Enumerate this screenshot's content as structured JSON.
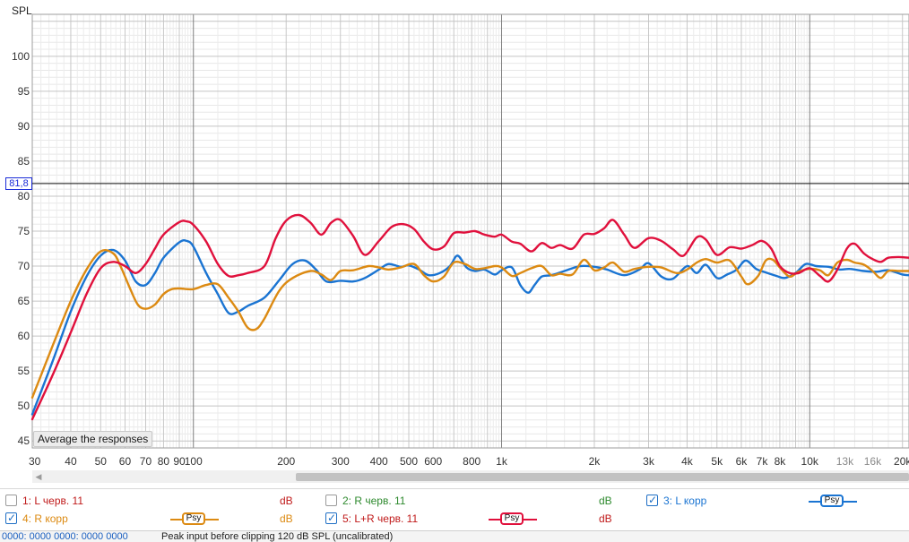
{
  "chart_data": {
    "type": "line",
    "title": "",
    "ylabel": "SPL",
    "xlabel": "",
    "xscale": "log",
    "xlim": [
      30,
      21000
    ],
    "ylim": [
      44,
      106
    ],
    "yticks": [
      "45",
      "50",
      "55",
      "60",
      "65",
      "70",
      "75",
      "80",
      "85",
      "90",
      "95",
      "100"
    ],
    "xticks": [
      {
        "f": 30,
        "label": "30"
      },
      {
        "f": 40,
        "label": "40"
      },
      {
        "f": 50,
        "label": "50"
      },
      {
        "f": 60,
        "label": "60"
      },
      {
        "f": 70,
        "label": "70"
      },
      {
        "f": 80,
        "label": "80"
      },
      {
        "f": 90,
        "label": "90"
      },
      {
        "f": 100,
        "label": "100"
      },
      {
        "f": 200,
        "label": "200"
      },
      {
        "f": 300,
        "label": "300"
      },
      {
        "f": 400,
        "label": "400"
      },
      {
        "f": 500,
        "label": "500"
      },
      {
        "f": 600,
        "label": "600"
      },
      {
        "f": 800,
        "label": "800"
      },
      {
        "f": 1000,
        "label": "1k"
      },
      {
        "f": 2000,
        "label": "2k"
      },
      {
        "f": 3000,
        "label": "3k"
      },
      {
        "f": 4000,
        "label": "4k"
      },
      {
        "f": 5000,
        "label": "5k"
      },
      {
        "f": 6000,
        "label": "6k"
      },
      {
        "f": 7000,
        "label": "7k"
      },
      {
        "f": 8000,
        "label": "8k"
      },
      {
        "f": 10000,
        "label": "10k"
      },
      {
        "f": 13000,
        "label": "13k"
      },
      {
        "f": 16000,
        "label": "16k"
      },
      {
        "f": 20000,
        "label": "20k"
      }
    ],
    "grid": true,
    "cursor_level": 81.8,
    "series": [
      {
        "name": "3: L корр",
        "color": "#1a74d2",
        "points": [
          [
            30,
            48.8
          ],
          [
            35,
            56.5
          ],
          [
            40,
            63.5
          ],
          [
            45,
            68.5
          ],
          [
            50,
            71.5
          ],
          [
            55,
            72.3
          ],
          [
            60,
            70.8
          ],
          [
            65,
            67.8
          ],
          [
            70,
            67.3
          ],
          [
            75,
            69
          ],
          [
            80,
            71.2
          ],
          [
            90,
            73.4
          ],
          [
            95,
            73.6
          ],
          [
            100,
            72.8
          ],
          [
            110,
            69
          ],
          [
            120,
            66
          ],
          [
            130,
            63.3
          ],
          [
            140,
            63.5
          ],
          [
            150,
            64.3
          ],
          [
            170,
            65.5
          ],
          [
            190,
            68
          ],
          [
            210,
            70.3
          ],
          [
            230,
            70.8
          ],
          [
            250,
            69.5
          ],
          [
            270,
            67.8
          ],
          [
            300,
            67.9
          ],
          [
            330,
            67.8
          ],
          [
            360,
            68.3
          ],
          [
            400,
            69.5
          ],
          [
            430,
            70.3
          ],
          [
            470,
            69.9
          ],
          [
            500,
            70.1
          ],
          [
            540,
            69.5
          ],
          [
            580,
            68.7
          ],
          [
            630,
            69
          ],
          [
            680,
            70
          ],
          [
            720,
            71.5
          ],
          [
            770,
            69.8
          ],
          [
            820,
            69.3
          ],
          [
            880,
            69.5
          ],
          [
            950,
            68.8
          ],
          [
            1000,
            69.4
          ],
          [
            1080,
            69.8
          ],
          [
            1150,
            67.3
          ],
          [
            1220,
            66.2
          ],
          [
            1280,
            67.3
          ],
          [
            1350,
            68.5
          ],
          [
            1450,
            68.7
          ],
          [
            1600,
            69.3
          ],
          [
            1800,
            70
          ],
          [
            2000,
            69.9
          ],
          [
            2200,
            69.5
          ],
          [
            2500,
            68.7
          ],
          [
            2800,
            69.5
          ],
          [
            3000,
            70.4
          ],
          [
            3300,
            68.5
          ],
          [
            3600,
            68.2
          ],
          [
            4000,
            70
          ],
          [
            4300,
            69
          ],
          [
            4600,
            70.2
          ],
          [
            5000,
            68.3
          ],
          [
            5400,
            68.8
          ],
          [
            5800,
            69.5
          ],
          [
            6200,
            70.8
          ],
          [
            6700,
            69.6
          ],
          [
            7200,
            69.1
          ],
          [
            7800,
            68.6
          ],
          [
            8300,
            68.3
          ],
          [
            9000,
            69
          ],
          [
            9700,
            70.3
          ],
          [
            10500,
            70
          ],
          [
            11500,
            69.9
          ],
          [
            12500,
            69.5
          ],
          [
            13500,
            69.6
          ],
          [
            15000,
            69.3
          ],
          [
            16500,
            69.2
          ],
          [
            18000,
            69.4
          ],
          [
            20000,
            68.8
          ],
          [
            21000,
            68.7
          ]
        ]
      },
      {
        "name": "4: R корр",
        "color": "#dc8a12",
        "points": [
          [
            30,
            51.2
          ],
          [
            35,
            58.7
          ],
          [
            40,
            65
          ],
          [
            45,
            69.5
          ],
          [
            50,
            72.1
          ],
          [
            55,
            71.8
          ],
          [
            58,
            70
          ],
          [
            62,
            67
          ],
          [
            66,
            64.5
          ],
          [
            70,
            63.9
          ],
          [
            75,
            64.5
          ],
          [
            80,
            66
          ],
          [
            85,
            66.7
          ],
          [
            90,
            66.8
          ],
          [
            100,
            66.7
          ],
          [
            110,
            67.3
          ],
          [
            120,
            67.4
          ],
          [
            130,
            65.5
          ],
          [
            140,
            63.5
          ],
          [
            150,
            61.2
          ],
          [
            160,
            61
          ],
          [
            170,
            62.5
          ],
          [
            190,
            66.5
          ],
          [
            210,
            68.3
          ],
          [
            240,
            69.3
          ],
          [
            260,
            68.8
          ],
          [
            280,
            68
          ],
          [
            300,
            69.3
          ],
          [
            330,
            69.4
          ],
          [
            370,
            70
          ],
          [
            400,
            69.8
          ],
          [
            430,
            69.5
          ],
          [
            470,
            69.8
          ],
          [
            520,
            70.3
          ],
          [
            560,
            68.7
          ],
          [
            600,
            67.8
          ],
          [
            650,
            68.5
          ],
          [
            700,
            70.5
          ],
          [
            760,
            70.3
          ],
          [
            820,
            69.6
          ],
          [
            880,
            69.7
          ],
          [
            950,
            70
          ],
          [
            1000,
            69.8
          ],
          [
            1080,
            68.6
          ],
          [
            1150,
            69
          ],
          [
            1250,
            69.7
          ],
          [
            1350,
            70
          ],
          [
            1450,
            68.7
          ],
          [
            1550,
            68.9
          ],
          [
            1700,
            68.8
          ],
          [
            1850,
            70.9
          ],
          [
            2000,
            69.4
          ],
          [
            2150,
            69.8
          ],
          [
            2300,
            70.5
          ],
          [
            2500,
            69.2
          ],
          [
            2700,
            69.6
          ],
          [
            3000,
            69.9
          ],
          [
            3300,
            69.8
          ],
          [
            3700,
            69
          ],
          [
            4000,
            69.5
          ],
          [
            4300,
            70.5
          ],
          [
            4600,
            71
          ],
          [
            5000,
            70.5
          ],
          [
            5500,
            70.8
          ],
          [
            6000,
            68.5
          ],
          [
            6300,
            67.4
          ],
          [
            6800,
            68.6
          ],
          [
            7200,
            70.8
          ],
          [
            7600,
            70.9
          ],
          [
            8000,
            69.8
          ],
          [
            8600,
            68.5
          ],
          [
            9200,
            69.2
          ],
          [
            10000,
            69.6
          ],
          [
            10800,
            69.4
          ],
          [
            11500,
            68.7
          ],
          [
            12300,
            70.5
          ],
          [
            13200,
            70.9
          ],
          [
            14000,
            70.5
          ],
          [
            15000,
            70.2
          ],
          [
            16000,
            69.3
          ],
          [
            17000,
            68.3
          ],
          [
            18000,
            69.3
          ],
          [
            19500,
            69.3
          ],
          [
            21000,
            69.3
          ]
        ]
      },
      {
        "name": "5: L+R черв. 11",
        "color": "#e0103c",
        "points": [
          [
            30,
            48.1
          ],
          [
            35,
            54.5
          ],
          [
            40,
            60.5
          ],
          [
            45,
            66
          ],
          [
            50,
            69.7
          ],
          [
            55,
            70.6
          ],
          [
            60,
            70
          ],
          [
            65,
            69
          ],
          [
            70,
            70.3
          ],
          [
            75,
            72.5
          ],
          [
            80,
            74.5
          ],
          [
            90,
            76.3
          ],
          [
            95,
            76.4
          ],
          [
            100,
            75.9
          ],
          [
            110,
            73.5
          ],
          [
            120,
            70.3
          ],
          [
            130,
            68.6
          ],
          [
            140,
            68.7
          ],
          [
            150,
            69
          ],
          [
            170,
            70
          ],
          [
            185,
            74
          ],
          [
            200,
            76.5
          ],
          [
            220,
            77.3
          ],
          [
            240,
            76.2
          ],
          [
            260,
            74.5
          ],
          [
            280,
            76.2
          ],
          [
            300,
            76.6
          ],
          [
            330,
            74.3
          ],
          [
            360,
            71.6
          ],
          [
            400,
            73.6
          ],
          [
            440,
            75.6
          ],
          [
            480,
            76
          ],
          [
            520,
            75.3
          ],
          [
            560,
            73.5
          ],
          [
            600,
            72.4
          ],
          [
            650,
            72.8
          ],
          [
            700,
            74.7
          ],
          [
            760,
            74.8
          ],
          [
            820,
            75
          ],
          [
            880,
            74.5
          ],
          [
            950,
            74.2
          ],
          [
            1000,
            74.5
          ],
          [
            1080,
            73.5
          ],
          [
            1150,
            73.2
          ],
          [
            1250,
            72.1
          ],
          [
            1350,
            73.3
          ],
          [
            1450,
            72.6
          ],
          [
            1550,
            73
          ],
          [
            1700,
            72.5
          ],
          [
            1850,
            74.5
          ],
          [
            2000,
            74.6
          ],
          [
            2150,
            75.4
          ],
          [
            2300,
            76.6
          ],
          [
            2500,
            74.5
          ],
          [
            2700,
            72.6
          ],
          [
            3000,
            74
          ],
          [
            3300,
            73.6
          ],
          [
            3600,
            72.4
          ],
          [
            3900,
            71.5
          ],
          [
            4300,
            74.1
          ],
          [
            4600,
            73.8
          ],
          [
            5000,
            71.6
          ],
          [
            5500,
            72.7
          ],
          [
            6000,
            72.5
          ],
          [
            6500,
            73
          ],
          [
            7000,
            73.6
          ],
          [
            7500,
            72.5
          ],
          [
            8000,
            70
          ],
          [
            8600,
            69
          ],
          [
            9200,
            69
          ],
          [
            10000,
            69.7
          ],
          [
            10800,
            68.6
          ],
          [
            11500,
            67.8
          ],
          [
            12300,
            69.5
          ],
          [
            13200,
            72.5
          ],
          [
            14000,
            73.2
          ],
          [
            15000,
            71.8
          ],
          [
            16000,
            71
          ],
          [
            17000,
            70.6
          ],
          [
            18000,
            71.2
          ],
          [
            19500,
            71.3
          ],
          [
            21000,
            71.2
          ]
        ]
      }
    ]
  },
  "ui": {
    "average_button": "Average the responses",
    "cursor_readout": "81,8"
  },
  "legend": {
    "items": [
      {
        "label": "1: L черв. 11",
        "color": "#c01a1a",
        "checked": false,
        "db": "dB",
        "db_color": "#c01a1a"
      },
      {
        "label": "2: R черв. 11",
        "color": "#2e8a2e",
        "checked": false,
        "db": "dB",
        "db_color": "#2e8a2e"
      },
      {
        "label": "3: L корр",
        "color": "#1a74d2",
        "checked": true,
        "psy": "Psy"
      },
      {
        "label": "4: R корр",
        "color": "#dc8a12",
        "checked": true,
        "psy": "Psy",
        "db": "dB",
        "db_color": "#dc8a12"
      },
      {
        "label": "5: L+R черв. 11",
        "color": "#c01a1a",
        "checked": true,
        "psy": "Psy",
        "db": "dB",
        "db_color": "#c01a1a"
      }
    ],
    "line_colors": {
      "item5": "#e0103c"
    }
  },
  "status": {
    "left": "0000: 0000 0000: 0000 0000",
    "right": "Peak input before clipping 120 dB SPL (uncalibrated)"
  }
}
